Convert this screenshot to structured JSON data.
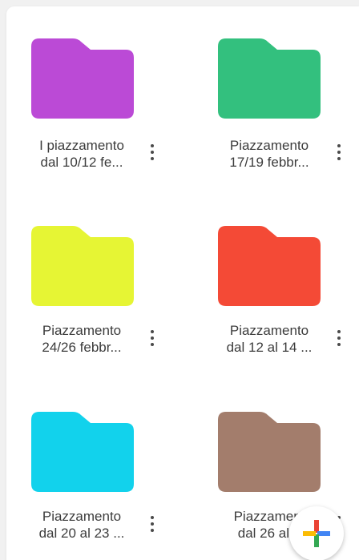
{
  "folders": [
    {
      "line1": "I piazzamento",
      "line2": "dal 10/12 fe...",
      "color": "#bb4ad6",
      "icon": "folder-icon"
    },
    {
      "line1": "Piazzamento",
      "line2": "17/19 febbr...",
      "color": "#33c07e",
      "icon": "folder-icon"
    },
    {
      "line1": "Piazzamento",
      "line2": "24/26 febbr...",
      "color": "#e6f534",
      "icon": "folder-icon"
    },
    {
      "line1": "Piazzamento",
      "line2": "dal 12 al 14 ...",
      "color": "#f44a36",
      "icon": "folder-icon"
    },
    {
      "line1": "Piazzamento",
      "line2": "dal 20 al 23 ...",
      "color": "#12d2ec",
      "icon": "folder-icon"
    },
    {
      "line1": "Piazzament",
      "line2": "dal 26 al 2",
      "color": "#a37d6c",
      "icon": "folder-icon"
    }
  ],
  "more_icon": "more-vert-icon",
  "fab": {
    "icon": "plus-icon",
    "colors": {
      "red": "#ea4335",
      "blue": "#4285f4",
      "green": "#34a853",
      "yellow": "#fbbc05"
    }
  }
}
